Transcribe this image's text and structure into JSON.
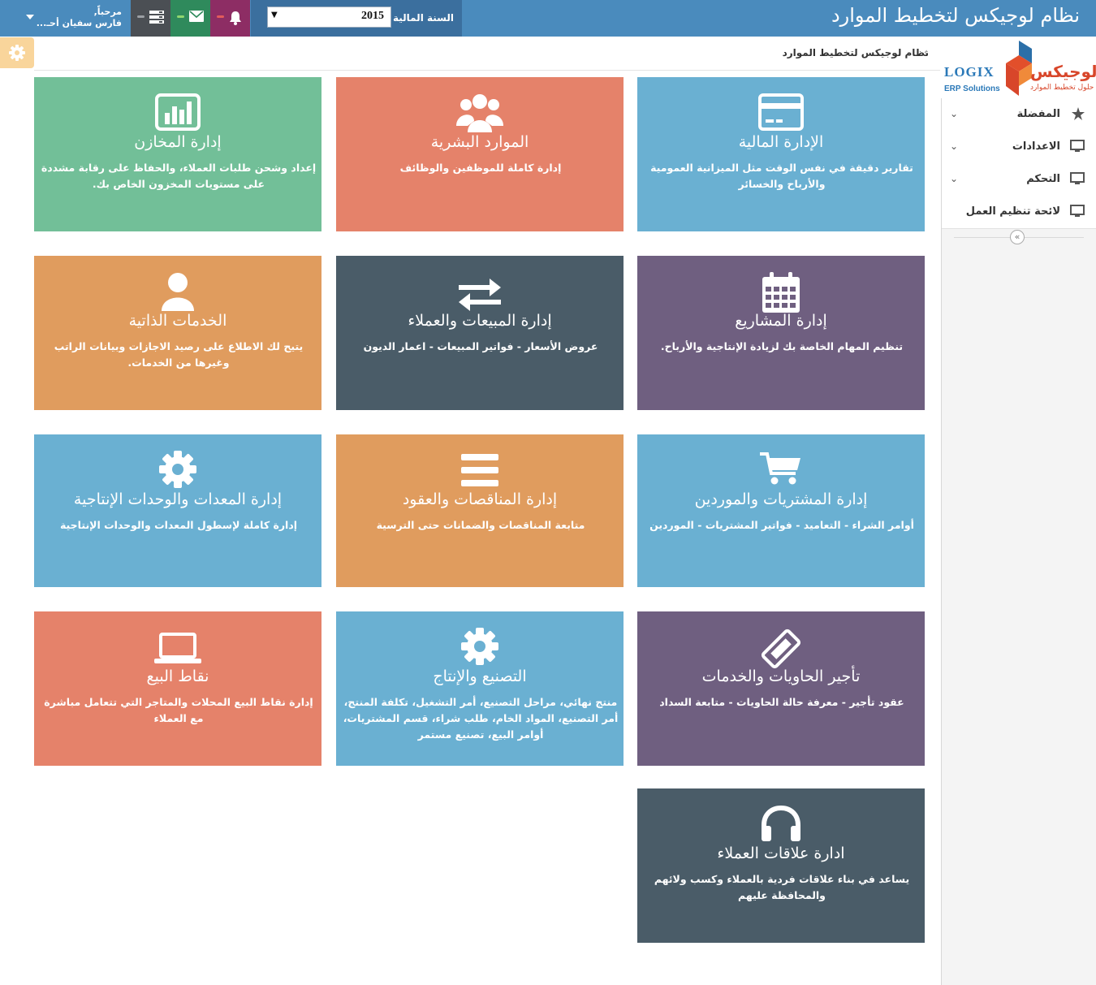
{
  "header": {
    "app_title": "نظام لوجيكس لتخطيط الموارد",
    "fiscal_year_label": "السنة المالية",
    "fiscal_year_value": "2015",
    "user_greeting": "مرحباً,",
    "user_name": "فارس سفيان أحـ..."
  },
  "breadcrumb": {
    "current": "نظام لوجيكس لتخطيط الموارد"
  },
  "logo": {
    "ar_name": "لوجيكس",
    "ar_tagline": "حلول تخطيط الموارد",
    "en_name": "LOGIX",
    "en_tagline": "ERP Solutions"
  },
  "sidebar": {
    "items": [
      {
        "label": "المفضلة",
        "icon": "star-icon"
      },
      {
        "label": "الاعدادات",
        "icon": "monitor-icon"
      },
      {
        "label": "التحكم",
        "icon": "monitor-icon"
      },
      {
        "label": "لائحة تنظيم العمل",
        "icon": "monitor-icon"
      }
    ]
  },
  "tiles": [
    {
      "title": "الإدارة المالية",
      "desc": "تقارير دقيقة في نفس الوقت مثل الميزانية العمومية والأرباح والخسائر",
      "icon": "credit-card-icon",
      "color": "#6ab0d2"
    },
    {
      "title": "الموارد البشرية",
      "desc": "إدارة كاملة للموظفين والوظائف",
      "icon": "users-icon",
      "color": "#e5826a"
    },
    {
      "title": "إدارة المخازن",
      "desc": "إعداد وشحن طلبات العملاء، والحفاظ على رقابة مشددة على مستويات المخزون الخاص بك.",
      "icon": "bar-chart-icon",
      "color": "#72bf98"
    },
    {
      "title": "إدارة المشاريع",
      "desc": "تنظيم المهام الخاصة بك لزيادة الإنتاجية والأرباح.",
      "icon": "calendar-icon",
      "color": "#6f5f80"
    },
    {
      "title": "إدارة المبيعات والعملاء",
      "desc": "عروض الأسعار - فواتير المبيعات - اعمار الديون",
      "icon": "exchange-icon",
      "color": "#4a5c68"
    },
    {
      "title": "الخدمات الذاتية",
      "desc": "يتيح لك الاطلاع على رصيد الاجازات وبيانات الراتب وغيرها من الخدمات.",
      "icon": "user-icon",
      "color": "#e09c5e"
    },
    {
      "title": "إدارة المشتريات والموردين",
      "desc": "أوامر الشراء - التعاميد - فواتير المشتريات - الموردين",
      "icon": "cart-icon",
      "color": "#6ab0d2"
    },
    {
      "title": "إدارة المناقصات والعقود",
      "desc": "متابعة المناقصات والضمانات حتى الترسية",
      "icon": "list-icon",
      "color": "#e09c5e"
    },
    {
      "title": "إدارة المعدات والوحدات الإنتاجية",
      "desc": "إدارة كاملة لإسطول المعدات والوحدات الإنتاجية",
      "icon": "gear-icon",
      "color": "#6ab0d2"
    },
    {
      "title": "تأجير الحاويات والخدمات",
      "desc": "عقود تأجير - معرفة حالة الحاويات - متابعة السداد",
      "icon": "ticket-icon",
      "color": "#6f5f80"
    },
    {
      "title": "التصنيع والإنتاج",
      "desc": "منتج نهائي، مراحل التصنيع، أمر التشغيل، تكلفة المنتج، أمر التصنيع، المواد الخام، طلب شراء، قسم المشتريات، أوامر البيع، تصنيع مستمر",
      "icon": "gear-icon",
      "color": "#6ab0d2"
    },
    {
      "title": "نقاط البيع",
      "desc": "إدارة نقاط البيع المحلات والمتاجر التي تتعامل مباشرة مع العملاء",
      "icon": "laptop-icon",
      "color": "#e5826a"
    },
    {
      "title": "ادارة علاقات العملاء",
      "desc": "يساعد في بناء علاقات فردية بالعملاء وكسب ولائهم والمحافظة عليهم",
      "icon": "headphones-icon",
      "color": "#4a5c68"
    }
  ]
}
